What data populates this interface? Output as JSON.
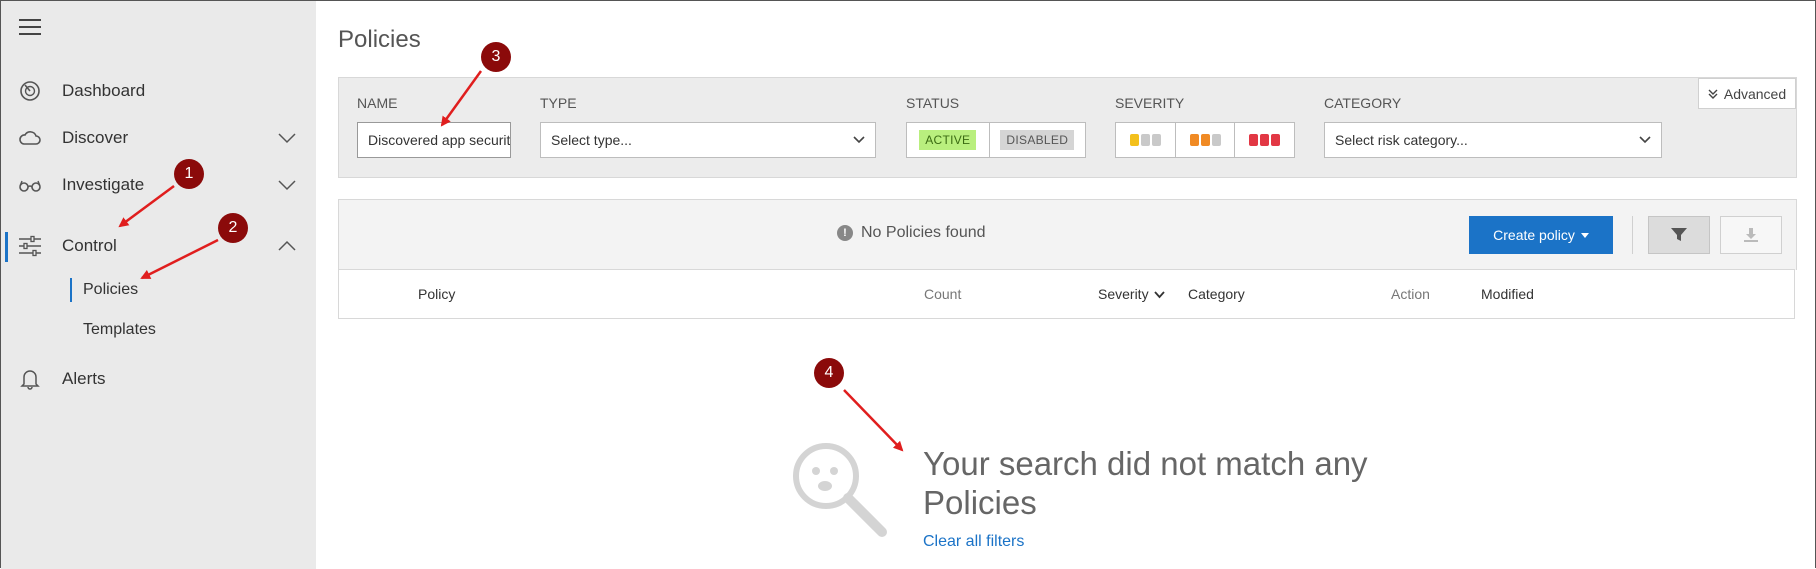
{
  "sidebar": {
    "items": [
      {
        "label": "Dashboard",
        "icon": "gauge-icon"
      },
      {
        "label": "Discover",
        "icon": "cloud-icon"
      },
      {
        "label": "Investigate",
        "icon": "glasses-icon"
      },
      {
        "label": "Control",
        "icon": "sliders-icon"
      },
      {
        "label": "Alerts",
        "icon": "bell-icon"
      }
    ],
    "control_subitems": [
      "Policies",
      "Templates"
    ]
  },
  "page": {
    "title": "Policies"
  },
  "filters": {
    "name": {
      "label": "NAME",
      "value": "Discovered app security"
    },
    "type": {
      "label": "TYPE",
      "value": "Select type..."
    },
    "status": {
      "label": "STATUS",
      "active": "ACTIVE",
      "disabled": "DISABLED"
    },
    "severity": {
      "label": "SEVERITY"
    },
    "category": {
      "label": "CATEGORY",
      "value": "Select risk category..."
    },
    "advanced": "Advanced"
  },
  "results": {
    "message": "No Policies found",
    "create_button": "Create policy"
  },
  "table": {
    "columns": [
      "Policy",
      "Count",
      "Severity",
      "Category",
      "Action",
      "Modified"
    ]
  },
  "empty": {
    "message_line1": "Your search did not match any",
    "message_line2": "Policies",
    "clear_link": "Clear all filters"
  },
  "annotations": [
    "1",
    "2",
    "3",
    "4"
  ],
  "colors": {
    "accent": "#1b73c7",
    "sidebar_bg": "#eaeaea",
    "callout": "#8b0a0a",
    "arrow": "#e01e1e",
    "severity_low": "#f3c01c",
    "severity_medium": "#f08a24",
    "severity_high": "#e23744",
    "active_badge": "#b9ef7e"
  }
}
